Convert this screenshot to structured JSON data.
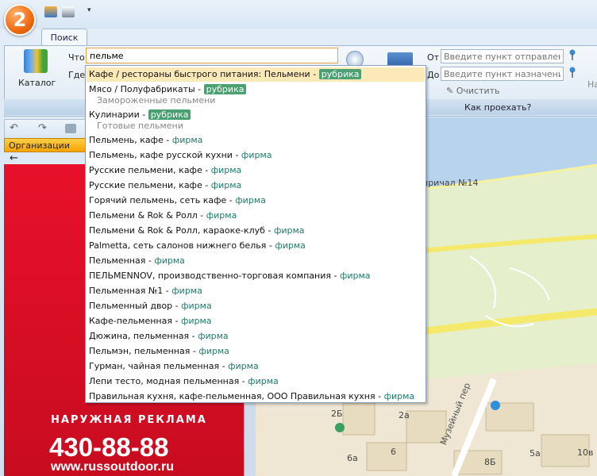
{
  "app": {
    "logo_text": "2"
  },
  "tabs": [
    {
      "label": "Поиск"
    }
  ],
  "ribbon": {
    "catalog_label": "Каталог",
    "what_label": "Что",
    "where_label": "Где",
    "search_value": "пельме",
    "from_label": "От",
    "to_label": "До",
    "from_placeholder": "Введите пункт отправления",
    "to_placeholder": "Введите пункт назначения",
    "clear_label": "Очистить",
    "how_to_get_label": "Как проехать?",
    "na_label": "На"
  },
  "left_panel": {
    "org_tab": "Организации",
    "back": "←",
    "banner": {
      "heading": "НАРУЖНАЯ РЕКЛАМА",
      "phone": "430-88-88",
      "url": "www.russoutdoor.ru"
    }
  },
  "suggestions": [
    {
      "text": "Кафе / рестораны быстрого питания: Пельмени",
      "kind": "рубрика",
      "badge": true,
      "selected": true
    },
    {
      "text": "Мясо / Полуфабрикаты",
      "kind": "рубрика",
      "badge": true,
      "sub": "Замороженные пельмени"
    },
    {
      "text": "Кулинарии",
      "kind": "рубрика",
      "badge": true,
      "sub": "Готовые пельмени"
    },
    {
      "text": "Пельмень, кафе",
      "kind": "фирма"
    },
    {
      "text": "Пельмень, кафе русской кухни",
      "kind": "фирма"
    },
    {
      "text": "Русские пельмени, кафе",
      "kind": "фирма"
    },
    {
      "text": "Русские пельмени, кафе",
      "kind": "фирма"
    },
    {
      "text": "Горячий пельмень, сеть кафе",
      "kind": "фирма"
    },
    {
      "text": "Пельмени & Rok & Ролл",
      "kind": "фирма"
    },
    {
      "text": "Пельмени & Rok & Ролл, караоке-клуб",
      "kind": "фирма"
    },
    {
      "text": "Palmetta, сеть салонов нижнего белья",
      "kind": "фирма"
    },
    {
      "text": "Пельменная",
      "kind": "фирма"
    },
    {
      "text": "ПЕЛЬМЕNNOV, производственно-торговая компания",
      "kind": "фирма"
    },
    {
      "text": "Пельменная №1",
      "kind": "фирма"
    },
    {
      "text": "Пельменный двор",
      "kind": "фирма"
    },
    {
      "text": "Кафе-пельменная",
      "kind": "фирма"
    },
    {
      "text": "Дюжина, пельменная",
      "kind": "фирма"
    },
    {
      "text": "Пельмэн, пельменная",
      "kind": "фирма"
    },
    {
      "text": "Гурман, чайная пельменная",
      "kind": "фирма"
    },
    {
      "text": "Лепи тесто, модная пельменная",
      "kind": "фирма"
    },
    {
      "text": "Правильная кухня, кафе-пельменная, ООО Правильная кухня",
      "kind": "фирма"
    }
  ],
  "map": {
    "labels": [
      "причал №14",
      "2Б",
      "2а",
      "6а",
      "6",
      "8Б",
      "5а",
      "10в",
      "Музейный пер"
    ]
  }
}
